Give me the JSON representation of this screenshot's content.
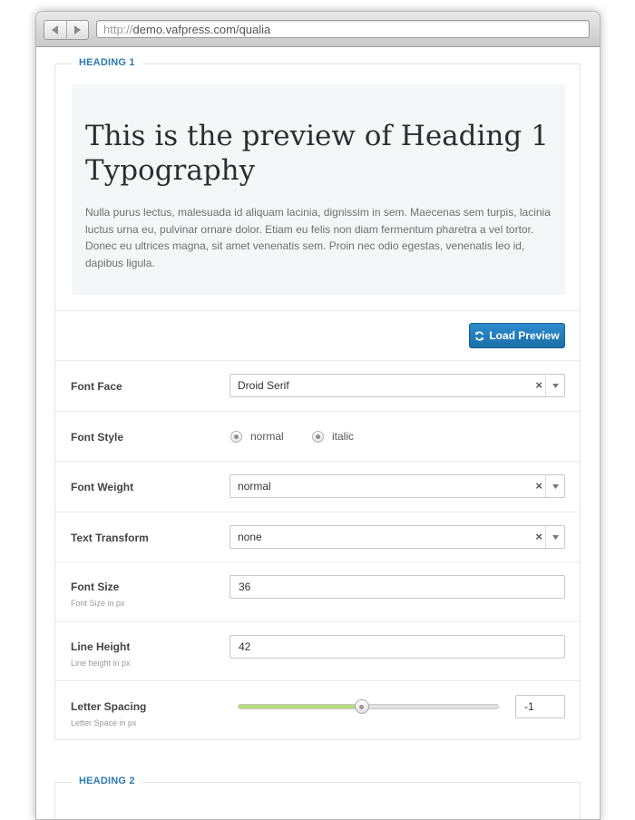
{
  "browser": {
    "url_protocol": "http://",
    "url_rest": "demo.vafpress.com/qualia"
  },
  "heading1": {
    "legend": "HEADING 1",
    "preview_title": "This is the preview of Heading 1 Typography",
    "preview_text": "Nulla purus lectus, malesuada id aliquam lacinia, dignissim in sem. Maecenas sem turpis, lacinia luctus urna eu, pulvinar ornare dolor. Etiam eu felis non diam fermentum pharetra a vel tortor. Donec eu ultrices magna, sit amet venenatis sem. Proin nec odio egestas, venenatis leo id, dapibus ligula.",
    "load_preview_label": "Load Preview",
    "font_face": {
      "label": "Font Face",
      "value": "Droid Serif"
    },
    "font_style": {
      "label": "Font Style",
      "options": [
        "normal",
        "italic"
      ]
    },
    "font_weight": {
      "label": "Font Weight",
      "value": "normal"
    },
    "text_transform": {
      "label": "Text Transform",
      "value": "none"
    },
    "font_size": {
      "label": "Font Size",
      "hint": "Font Size in px",
      "value": "36"
    },
    "line_height": {
      "label": "Line Height",
      "hint": "Line height in px",
      "value": "42"
    },
    "letter_spacing": {
      "label": "Letter Spacing",
      "hint": "Letter Space in px",
      "value": "-1",
      "slider_fraction": 0.475
    }
  },
  "heading2": {
    "legend": "HEADING 2"
  },
  "icons": {
    "clear": "×",
    "accent": "#2a7ab0",
    "button_color": "#1f79b8",
    "slider_fill_color": "#b9dc7c"
  }
}
